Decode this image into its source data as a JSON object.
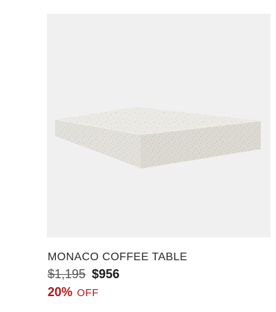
{
  "product": {
    "image_alt": "Monaco Coffee Table",
    "name": "MONACO COFFEE TABLE",
    "original_price": "$1,195",
    "sale_price": "$956",
    "discount_percent": "20%",
    "discount_suffix": "OFF"
  },
  "colors": {
    "image_background": "#f0f0f0",
    "discount": "#b0171f",
    "text": "#2a2a2a"
  }
}
